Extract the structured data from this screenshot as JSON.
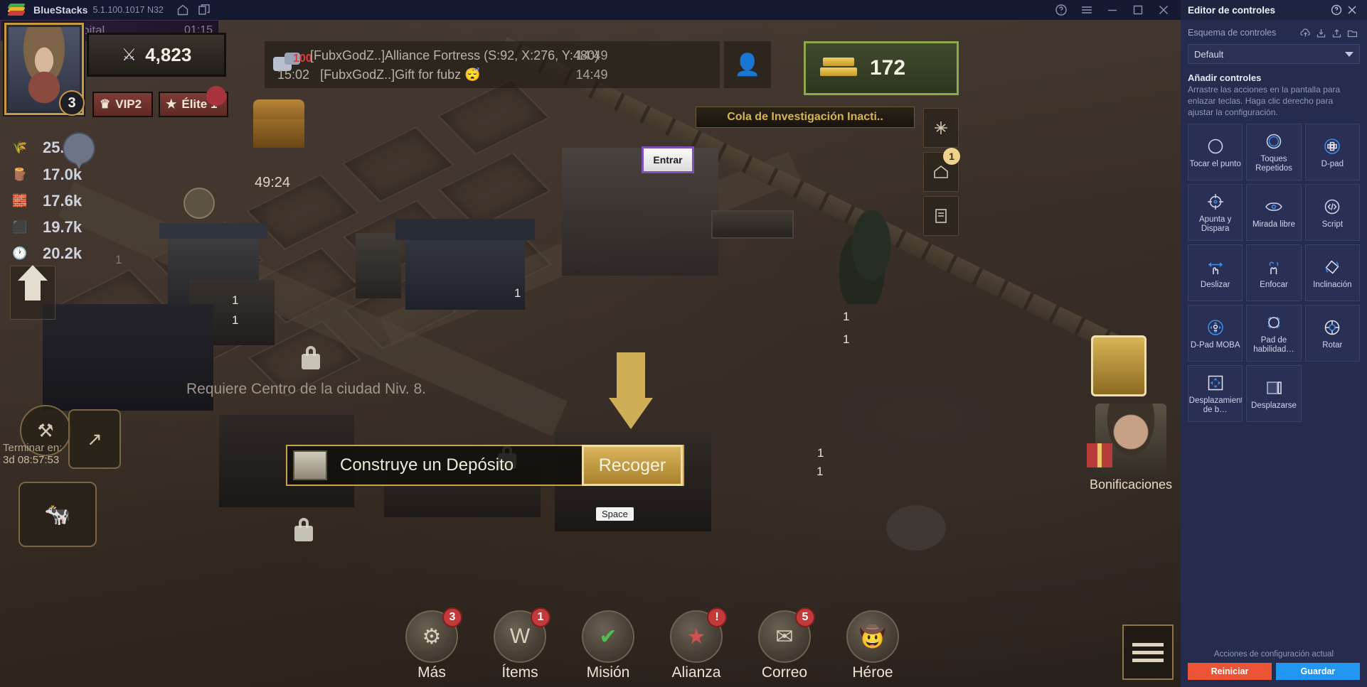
{
  "titlebar": {
    "app_name": "BlueStacks",
    "version": "5.1.100.1017 N32",
    "home_icon": "home-icon",
    "multi_instance_icon": "multi-instance-icon",
    "help_icon": "help-icon",
    "menu_icon": "hamburger-menu-icon",
    "minimize_icon": "minimize-icon",
    "maximize_icon": "maximize-icon",
    "close_icon": "close-icon"
  },
  "game": {
    "player": {
      "power": "4,823",
      "level": "3",
      "vip": "VIP2",
      "elite": "Élite 1"
    },
    "resources": [
      {
        "icon": "wheat-icon",
        "value": "25.6k"
      },
      {
        "icon": "wood-icon",
        "value": "17.0k"
      },
      {
        "icon": "stone-icon",
        "value": "17.6k"
      },
      {
        "icon": "iron-icon",
        "value": "19.7k"
      },
      {
        "icon": "clock-icon",
        "value": "20.2k"
      }
    ],
    "resource_extra": "1",
    "chat": {
      "badge": "100",
      "line1": "[FubxGodZ..]Alliance Fortress (S:92, X:276, Y:480)",
      "line1_time": "14:49",
      "line2_time": "15:02",
      "line2": "[FubxGodZ..]Gift for fubz 😴",
      "line2_time_right": "14:49",
      "alliance_icon": "alliance-members-icon"
    },
    "gold": {
      "value": "172",
      "icon": "gold-ingot-icon"
    },
    "research_banner": "Cola de Investigación Inacti..",
    "hospital": {
      "label": "Niv. 1 Hospital",
      "time": "01:15",
      "enter": "Entrar"
    },
    "side_buttons": [
      {
        "name": "world-map-button",
        "icon": "crossed-arrows-icon",
        "badge": ""
      },
      {
        "name": "city-view-button",
        "icon": "house-icon",
        "badge": "1"
      },
      {
        "name": "inventory-button",
        "icon": "scroll-icon",
        "badge": ""
      }
    ],
    "requires_notice": "Requiere Centro de la ciudad Niv. 8.",
    "chest_timer": "49:24",
    "terminar": {
      "label": "Terminar en:",
      "time": "3d 08:57:53"
    },
    "quest": {
      "text": "Construye un Depósito",
      "action": "Recoger"
    },
    "space_tip": "Space",
    "bonificaciones": "Bonificaciones",
    "plot_numbers": [
      "1",
      "1",
      "1",
      "1",
      "1",
      "1",
      "1"
    ],
    "bottom_nav": [
      {
        "label": "Más",
        "icon": "gear-icon",
        "badge": "3"
      },
      {
        "label": "Ítems",
        "icon": "bag-icon",
        "badge": "1"
      },
      {
        "label": "Misión",
        "icon": "check-icon",
        "badge": ""
      },
      {
        "label": "Alianza",
        "icon": "star-icon",
        "badge": "!"
      },
      {
        "label": "Correo",
        "icon": "mail-icon",
        "badge": "5"
      },
      {
        "label": "Héroe",
        "icon": "hero-icon",
        "badge": ""
      }
    ],
    "nav_list_icon": "list-icon"
  },
  "panel": {
    "title": "Editor de controles",
    "help_icon": "help-circle-icon",
    "close_icon": "close-icon",
    "scheme_label": "Esquema de controles",
    "scheme_icons": [
      "cloud-sync-icon",
      "import-icon",
      "export-icon",
      "folder-icon"
    ],
    "scheme_value": "Default",
    "add_title": "Añadir controles",
    "add_sub": "Arrastre las acciones en la pantalla para enlazar teclas. Haga clic derecho para ajustar la configuración.",
    "controls": [
      {
        "label": "Tocar el punto",
        "icon": "tap-circle-icon"
      },
      {
        "label": "Toques Repetidos",
        "icon": "repeat-tap-icon"
      },
      {
        "label": "D-pad",
        "icon": "dpad-icon"
      },
      {
        "label": "Apunta y Dispara",
        "icon": "aim-and-shoot-icon"
      },
      {
        "label": "Mirada libre",
        "icon": "free-look-icon"
      },
      {
        "label": "Script",
        "icon": "script-icon"
      },
      {
        "label": "Deslizar",
        "icon": "swipe-icon"
      },
      {
        "label": "Enfocar",
        "icon": "focus-icon"
      },
      {
        "label": "Inclinación",
        "icon": "tilt-icon"
      },
      {
        "label": "D-Pad MOBA",
        "icon": "dpad-moba-icon"
      },
      {
        "label": "Pad de habilidad…",
        "icon": "skill-pad-icon"
      },
      {
        "label": "Rotar",
        "icon": "rotate-icon"
      },
      {
        "label": "Desplazamiento de b…",
        "icon": "pan-icon"
      },
      {
        "label": "Desplazarse",
        "icon": "scroll-bar-icon"
      }
    ],
    "footer_label": "Acciones de configuración actual",
    "reset_label": "Reiniciar",
    "save_label": "Guardar",
    "accent_reset": "#ec5436",
    "accent_save": "#2196f3"
  }
}
